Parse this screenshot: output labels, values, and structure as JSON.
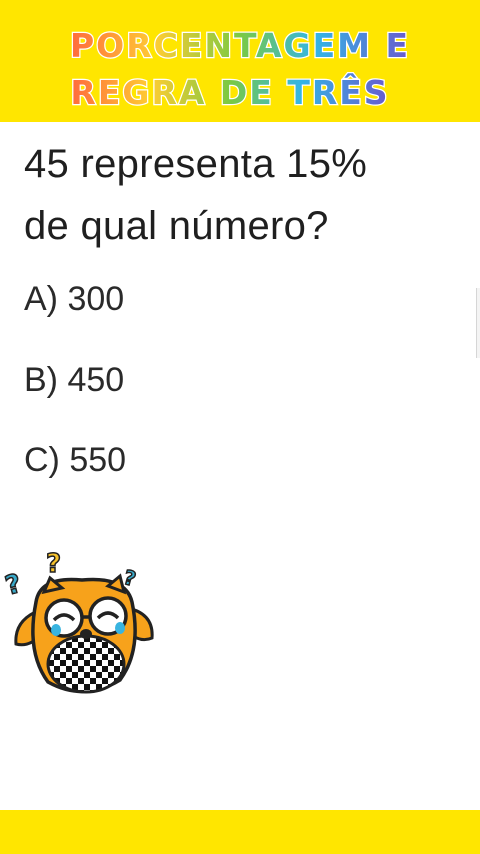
{
  "header": {
    "title_line1": "PORCENTAGEM E",
    "title_line2": "REGRA DE TRÊS",
    "background_color": "#ffe600"
  },
  "question": {
    "line1": "45 representa 15%",
    "line2": "de qual número?"
  },
  "options": [
    {
      "label": "A) 300"
    },
    {
      "label": "B) 450"
    },
    {
      "label": "C) 550"
    }
  ],
  "mascot": {
    "icon": "confused-owl-icon",
    "marks": [
      "?",
      "?",
      "?"
    ]
  },
  "footer": {
    "background_color": "#ffe600"
  }
}
